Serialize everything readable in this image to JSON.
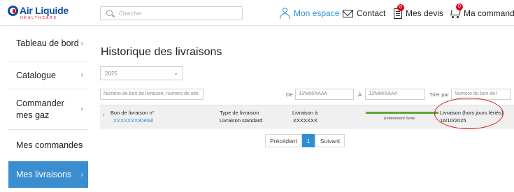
{
  "brand": {
    "name": "Air Liquide",
    "sub": "HEALTHCARE"
  },
  "search": {
    "placeholder": "Chercher"
  },
  "header_nav": [
    {
      "label": "Mon espace",
      "icon": "user-icon"
    },
    {
      "label": "Contact",
      "icon": "mail-icon"
    },
    {
      "label": "Mes devis",
      "icon": "document-icon",
      "badge": "0"
    },
    {
      "label": "Ma commande",
      "icon": "cart-icon",
      "badge": "0"
    }
  ],
  "sidebar": {
    "items": [
      {
        "label": "Tableau de bord",
        "active": false
      },
      {
        "label": "Catalogue",
        "active": false
      },
      {
        "label": "Commander mes gaz",
        "active": false
      },
      {
        "label": "Mes commandes",
        "active": false
      },
      {
        "label": "Mes livraisons",
        "active": true
      }
    ]
  },
  "main": {
    "title": "Historique des livraisons",
    "year_select": "2025",
    "filters": {
      "search_placeholder": "Numéro de bon de livraison, numéro de site",
      "from_label": "De",
      "from_placeholder": "JJ/MM/AAAA",
      "to_label": "À",
      "to_placeholder": "JJ/MM/AAAA",
      "sort_label": "Trier par",
      "sort_value": "Numéro du bon de l"
    },
    "delivery_row": {
      "bon_label": "Bon de livraison n°",
      "bon_value": "XXXXXXXX",
      "detail_link": "Détail",
      "type_label": "Type de livraison",
      "type_value": "Livraison standard",
      "to_label": "Livraison à",
      "to_value": "XXXXXXX",
      "status": "Entièrement livrée",
      "progress": 1.0,
      "date_label": "Livraison (hors jours fériés)",
      "date_value": "16/10/2025"
    },
    "pagination": {
      "prev": "Précédent",
      "current": "1",
      "next": "Suivant"
    }
  },
  "colors": {
    "accent": "#2a8fd3",
    "brand_blue": "#0a4ea2",
    "brand_red": "#e2001a",
    "progress": "#5aa832",
    "annotation": "#d7191f"
  }
}
